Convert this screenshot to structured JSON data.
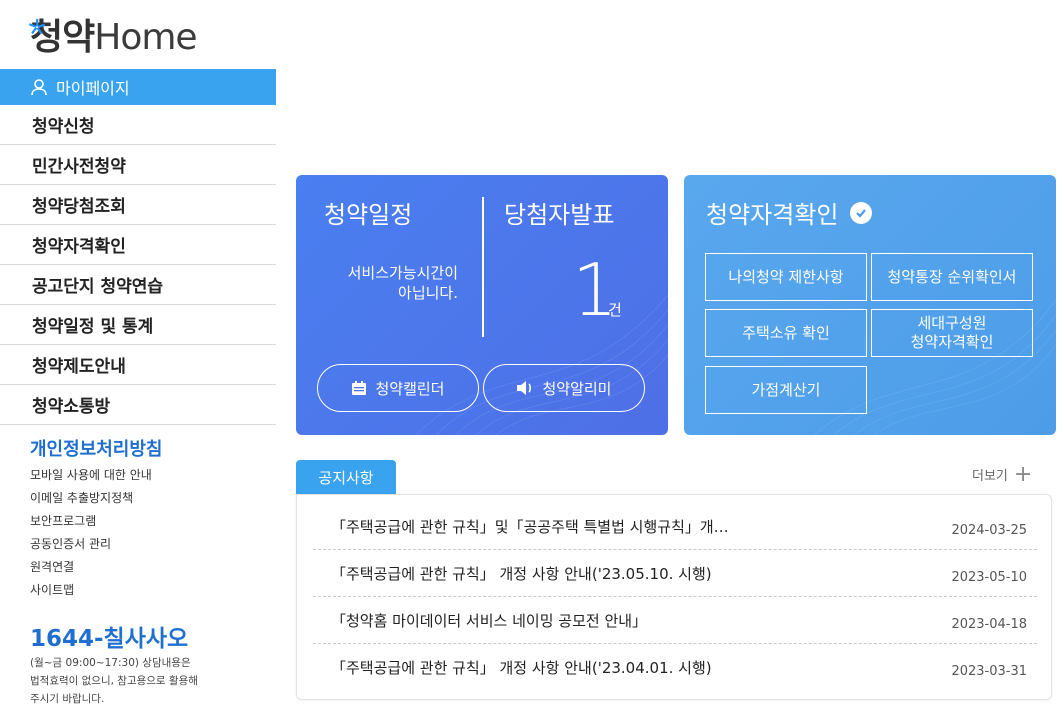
{
  "logo": {
    "kor": "청약",
    "eng": "Home"
  },
  "sidebar": {
    "mypage": "마이페이지",
    "items": [
      {
        "label": "청약신청"
      },
      {
        "label": "민간사전청약"
      },
      {
        "label": "청약당첨조회"
      },
      {
        "label": "청약자격확인"
      },
      {
        "label": "공고단지 청약연습"
      },
      {
        "label": "청약일정 및 통계"
      },
      {
        "label": "청약제도안내"
      },
      {
        "label": "청약소통방"
      }
    ],
    "policy": "개인정보처리방침",
    "links": [
      "모바일 사용에 대한 안내",
      "이메일 추출방지정책",
      "보안프로그램",
      "공동인증서 관리",
      "원격연결",
      "사이트맵"
    ],
    "phone": "1644-칠사사오",
    "phone_note_1": "(월~금 09:00~17:30) 상담내용은",
    "phone_note_2": "법적효력이 없으니, 참고용으로 활용해",
    "phone_note_3": "주시기 바랍니다."
  },
  "schedule_card": {
    "schedule_title": "청약일정",
    "announce_title": "당첨자발표",
    "service_msg_1": "서비스가능시간이",
    "service_msg_2": "아닙니다.",
    "count": "1",
    "count_unit": "건",
    "calendar_button": "청약캘린더",
    "alarm_button": "청약알리미"
  },
  "qualification_card": {
    "title": "청약자격확인",
    "buttons": {
      "restriction": "나의청약 제한사항",
      "account_rank": "청약통장 순위확인서",
      "house_owner": "주택소유 확인",
      "household_1": "세대구성원",
      "household_2": "청약자격확인",
      "points_calc": "가점계산기"
    }
  },
  "notice": {
    "tab": "공지사항",
    "more": "더보기",
    "items": [
      {
        "title": "「주택공급에 관한 규칙」및「공공주택 특별법 시행규칙」개…",
        "date": "2024-03-25"
      },
      {
        "title": "「주택공급에 관한 규칙」 개정 사항 안내('23.05.10. 시행)",
        "date": "2023-05-10"
      },
      {
        "title": "「청약홈 마이데이터 서비스 네이밍 공모전 안내」",
        "date": "2023-04-18"
      },
      {
        "title": "「주택공급에 관한 규칙」 개정 사항 안내('23.04.01. 시행)",
        "date": "2023-03-31"
      }
    ]
  },
  "colors": {
    "accent": "#3aa3ef",
    "card_left": "#4e78ec",
    "card_right": "#53a3ec",
    "link_blue": "#1f6fd1"
  }
}
